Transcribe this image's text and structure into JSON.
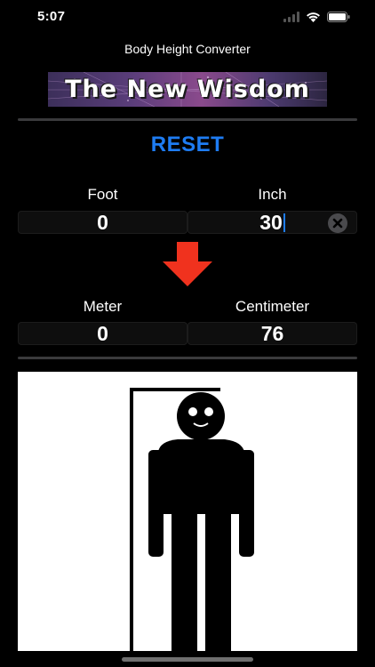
{
  "status_bar": {
    "time": "5:07"
  },
  "app": {
    "title": "Body Height Converter"
  },
  "banner": {
    "text": "The New Wisdom"
  },
  "reset": {
    "label": "RESET"
  },
  "input": {
    "foot_label": "Foot",
    "inch_label": "Inch",
    "foot_value": "0",
    "inch_value": "30"
  },
  "output": {
    "meter_label": "Meter",
    "centimeter_label": "Centimeter",
    "meter_value": "0",
    "centimeter_value": "76"
  },
  "colors": {
    "accent": "#1e7cf2",
    "arrow": "#f0321e",
    "background": "#000000"
  }
}
